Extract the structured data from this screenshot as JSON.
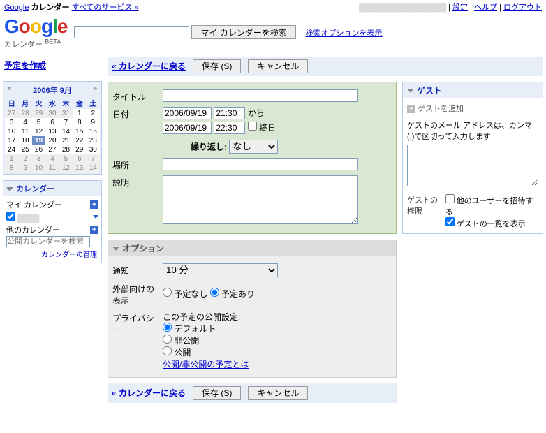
{
  "topbar": {
    "google": "Google",
    "calendar": "カレンダー",
    "allServices": "すべてのサービス »",
    "settings": "設定",
    "help": "ヘルプ",
    "logout": "ログアウト"
  },
  "logo": {
    "sub": "カレンダー",
    "beta": "BETA"
  },
  "search": {
    "btn": "マイ カレンダーを検索",
    "opts": "検索オプションを表示",
    "value": ""
  },
  "sidebar": {
    "create": "予定を作成",
    "miniCal": {
      "title": "2006年 9月",
      "dow": [
        "日",
        "月",
        "火",
        "水",
        "木",
        "金",
        "土"
      ],
      "weeks": [
        [
          {
            "d": 27,
            "dim": true
          },
          {
            "d": 28,
            "dim": true
          },
          {
            "d": 29,
            "dim": true
          },
          {
            "d": 30,
            "dim": true
          },
          {
            "d": 31,
            "dim": true
          },
          {
            "d": 1
          },
          {
            "d": 2
          }
        ],
        [
          {
            "d": 3
          },
          {
            "d": 4
          },
          {
            "d": 5
          },
          {
            "d": 6
          },
          {
            "d": 7
          },
          {
            "d": 8
          },
          {
            "d": 9
          }
        ],
        [
          {
            "d": 10
          },
          {
            "d": 11
          },
          {
            "d": 12
          },
          {
            "d": 13
          },
          {
            "d": 14
          },
          {
            "d": 15
          },
          {
            "d": 16
          }
        ],
        [
          {
            "d": 17
          },
          {
            "d": 18
          },
          {
            "d": 19,
            "today": true
          },
          {
            "d": 20
          },
          {
            "d": 21
          },
          {
            "d": 22
          },
          {
            "d": 23
          }
        ],
        [
          {
            "d": 24
          },
          {
            "d": 25
          },
          {
            "d": 26
          },
          {
            "d": 27
          },
          {
            "d": 28
          },
          {
            "d": 29
          },
          {
            "d": 30
          }
        ],
        [
          {
            "d": 1,
            "dim": true
          },
          {
            "d": 2,
            "dim": true
          },
          {
            "d": 3,
            "dim": true
          },
          {
            "d": 4,
            "dim": true
          },
          {
            "d": 5,
            "dim": true
          },
          {
            "d": 6,
            "dim": true
          },
          {
            "d": 7,
            "dim": true
          }
        ],
        [
          {
            "d": 8,
            "dim": true
          },
          {
            "d": 9,
            "dim": true
          },
          {
            "d": 10,
            "dim": true
          },
          {
            "d": 11,
            "dim": true
          },
          {
            "d": 12,
            "dim": true
          },
          {
            "d": 13,
            "dim": true
          },
          {
            "d": 14,
            "dim": true
          }
        ]
      ]
    },
    "calPanel": {
      "hdr": "カレンダー",
      "mine": "マイ カレンダー",
      "others": "他のカレンダー",
      "searchPh": "公開カレンダーを検索",
      "manage": "カレンダーの管理"
    }
  },
  "actions": {
    "back": "« カレンダーに戻る",
    "save": "保存 (S)",
    "cancel": "キャンセル"
  },
  "form": {
    "title": "タイトル",
    "titleVal": "",
    "date": "日付",
    "startDate": "2006/09/19",
    "startTime": "21:30",
    "endDate": "2006/09/19",
    "endTime": "22:30",
    "from": "から",
    "allDay": "終日",
    "repeat": "繰り返し:",
    "repeatVal": "なし",
    "place": "場所",
    "placeVal": "",
    "desc": "説明",
    "descVal": ""
  },
  "guests": {
    "hdr": "ゲスト",
    "add": "ゲストを追加",
    "hint": "ゲストのメール アドレスは、カンマ(,)で区切って入力します",
    "permLabel": "ゲストの権限",
    "invite": "他のユーザーを招待する",
    "viewList": "ゲストの一覧を表示"
  },
  "options": {
    "hdr": "オプション",
    "notify": "通知",
    "notifyVal": "10 分",
    "external": "外部向けの表示",
    "noPlans": "予定なし",
    "hasPlans": "予定あり",
    "privacy": "プライバシー",
    "privacySetting": "この予定の公開設定:",
    "default": "デフォルト",
    "private": "非公開",
    "public": "公開",
    "help": "公開/非公開の予定とは"
  }
}
